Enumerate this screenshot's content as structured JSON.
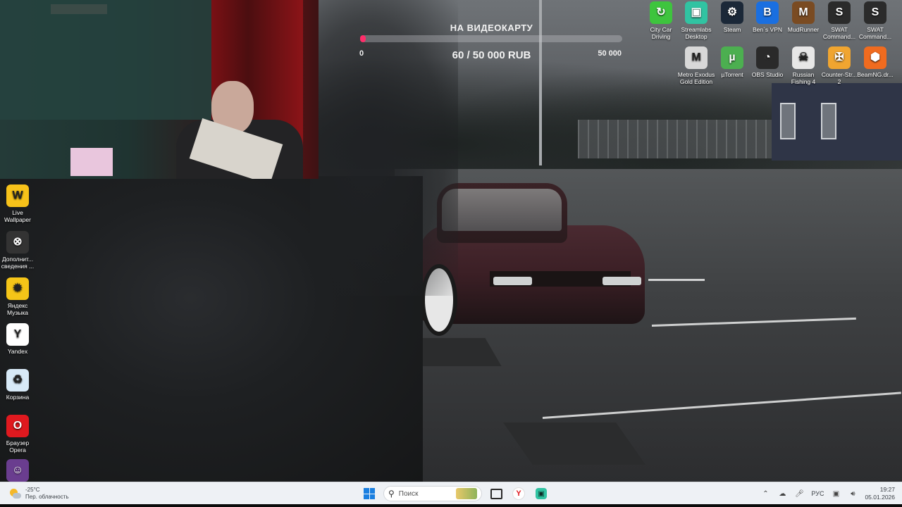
{
  "goal": {
    "title": "НА ВИДЕОКАРТУ",
    "min": "0",
    "max": "50 000",
    "amount": "60 / 50 000 RUB",
    "progress_fraction": 0.0012,
    "bar_color": "#ff2d6a"
  },
  "desktop": {
    "top_icons": [
      {
        "label": "City Car Driving",
        "icon": "city-car-driving-icon",
        "glyph": "↻",
        "color": "#3ec43e"
      },
      {
        "label": "Streamlabs Desktop",
        "icon": "streamlabs-icon",
        "glyph": "▣",
        "color": "#31c3a2"
      },
      {
        "label": "Steam",
        "icon": "steam-icon",
        "glyph": "⚙",
        "color": "#1b2838"
      },
      {
        "label": "Ben`s VPN",
        "icon": "vpn-icon",
        "glyph": "B",
        "color": "#1a6fe0"
      },
      {
        "label": "MudRunner",
        "icon": "mudrunner-icon",
        "glyph": "M",
        "color": "#7a4b22"
      },
      {
        "label": "SWAT Command...",
        "icon": "swat-icon",
        "glyph": "S",
        "color": "#2b2b2b"
      },
      {
        "label": "SWAT Command...",
        "icon": "swat-icon",
        "glyph": "S",
        "color": "#2b2b2b"
      },
      {
        "label": "Metro Exodus Gold Edition",
        "icon": "metro-exodus-icon",
        "glyph": "M",
        "color": "#d8d8d8"
      },
      {
        "label": "µTorrent",
        "icon": "utorrent-icon",
        "glyph": "µ",
        "color": "#4caf50"
      },
      {
        "label": "OBS Studio",
        "icon": "obs-icon",
        "glyph": "◔",
        "color": "#2a2a2a"
      },
      {
        "label": "Russian Fishing 4",
        "icon": "russian-fishing-icon",
        "glyph": "☠",
        "color": "#e7e7e7"
      },
      {
        "label": "Counter-Str... 2",
        "icon": "counter-strike-icon",
        "glyph": "✠",
        "color": "#f0a530"
      },
      {
        "label": "BeamNG.dr...",
        "icon": "beamng-icon",
        "glyph": "⬢",
        "color": "#f06b1f"
      }
    ],
    "left_icons": [
      {
        "label": "Live Wallpaper",
        "icon": "live-wallpaper-icon",
        "glyph": "W",
        "color": "#f7c21a"
      },
      {
        "label": "Дополнит... сведения ...",
        "icon": "additional-info-icon",
        "glyph": "⊗",
        "color": "#333333"
      },
      {
        "label": "Яндекс Музыка",
        "icon": "yandex-music-icon",
        "glyph": "✹",
        "color": "#f5c518"
      },
      {
        "label": "Yandex",
        "icon": "yandex-browser-icon",
        "glyph": "Y",
        "color": "#ffffff"
      },
      {
        "label": "Корзина",
        "icon": "recycle-bin-icon",
        "glyph": "♻",
        "color": "#d7e9f7"
      },
      {
        "label": "Браузер Opera",
        "icon": "opera-icon",
        "glyph": "O",
        "color": "#e0191f"
      },
      {
        "label": "",
        "icon": "user-avatar-icon",
        "glyph": "☺",
        "color": "#6a3d8f"
      }
    ]
  },
  "taskbar": {
    "weather_temp": "-25°C",
    "weather_desc": "Пер. облачность",
    "search_placeholder": "Поиск",
    "lang": "РУС",
    "time": "19:27",
    "date": "05.01.2026"
  }
}
